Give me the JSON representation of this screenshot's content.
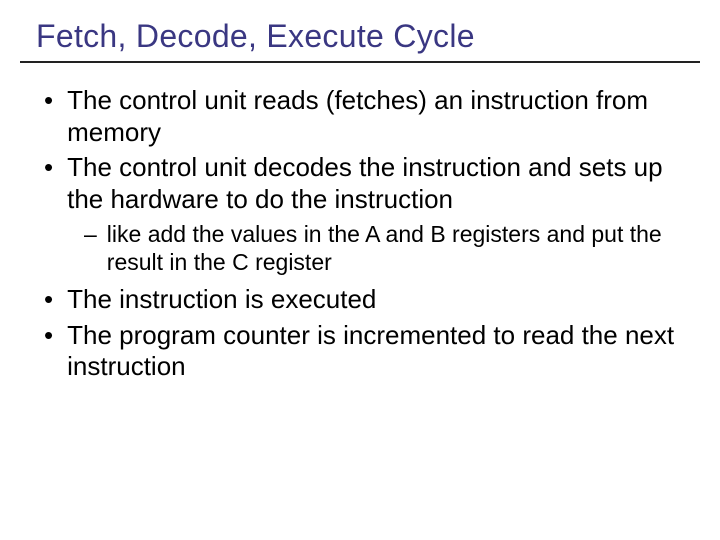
{
  "title": "Fetch, Decode, Execute Cycle",
  "bullets": [
    {
      "text": "The control unit reads (fetches) an instruction from memory"
    },
    {
      "text": "The control unit decodes the instruction and sets up the hardware to do the instruction",
      "sub": [
        "like add the values in the A and B registers and put the result in the C register"
      ]
    },
    {
      "text": "The instruction is executed"
    },
    {
      "text": "The program counter is incremented to read the next instruction"
    }
  ]
}
